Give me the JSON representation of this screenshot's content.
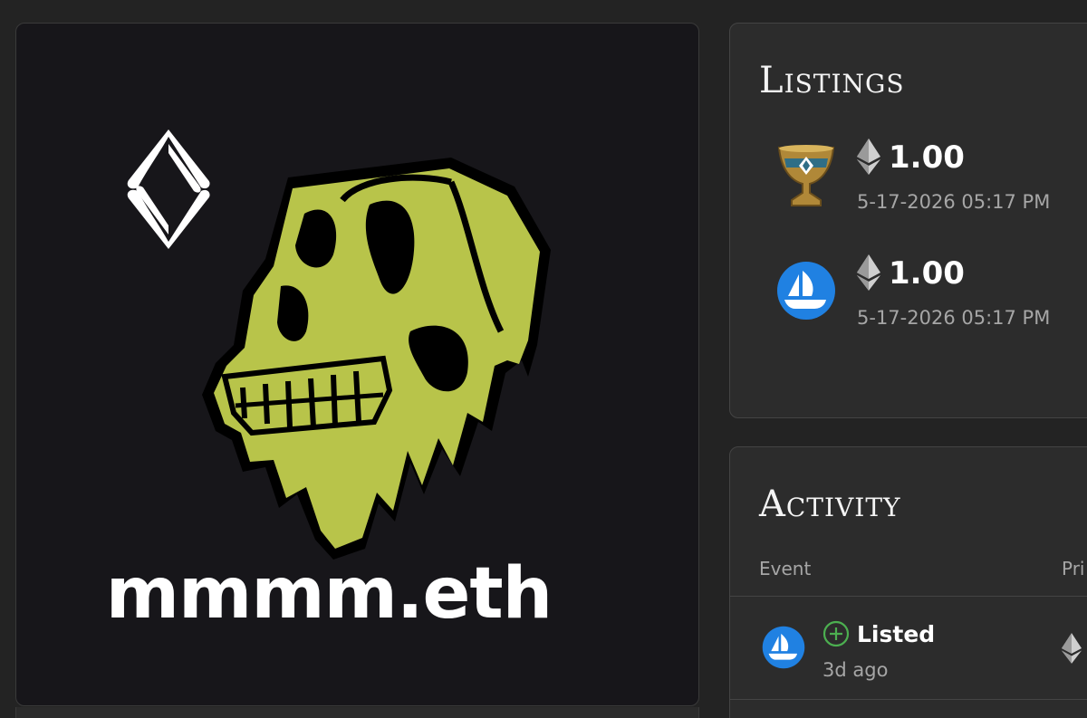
{
  "nft": {
    "name": "mmmm.eth",
    "logo_icon": "ens-logo-icon",
    "art_icon": "ape-skull-icon"
  },
  "listings": {
    "title": "Listings",
    "items": [
      {
        "marketplace_icon": "ens-grail-icon",
        "price": "1.00",
        "date": "5-17-2026 05:17 PM"
      },
      {
        "marketplace_icon": "opensea-icon",
        "price": "1.00",
        "date": "5-17-2026 05:17 PM"
      }
    ]
  },
  "activity": {
    "title": "Activity",
    "columns": {
      "event": "Event",
      "price": "Pri"
    },
    "rows": [
      {
        "marketplace_icon": "opensea-icon",
        "event": "Listed",
        "time": "3d ago"
      }
    ]
  },
  "colors": {
    "skull": "#b8c44a",
    "opensea": "#2081e2",
    "listed": "#4caf50"
  }
}
